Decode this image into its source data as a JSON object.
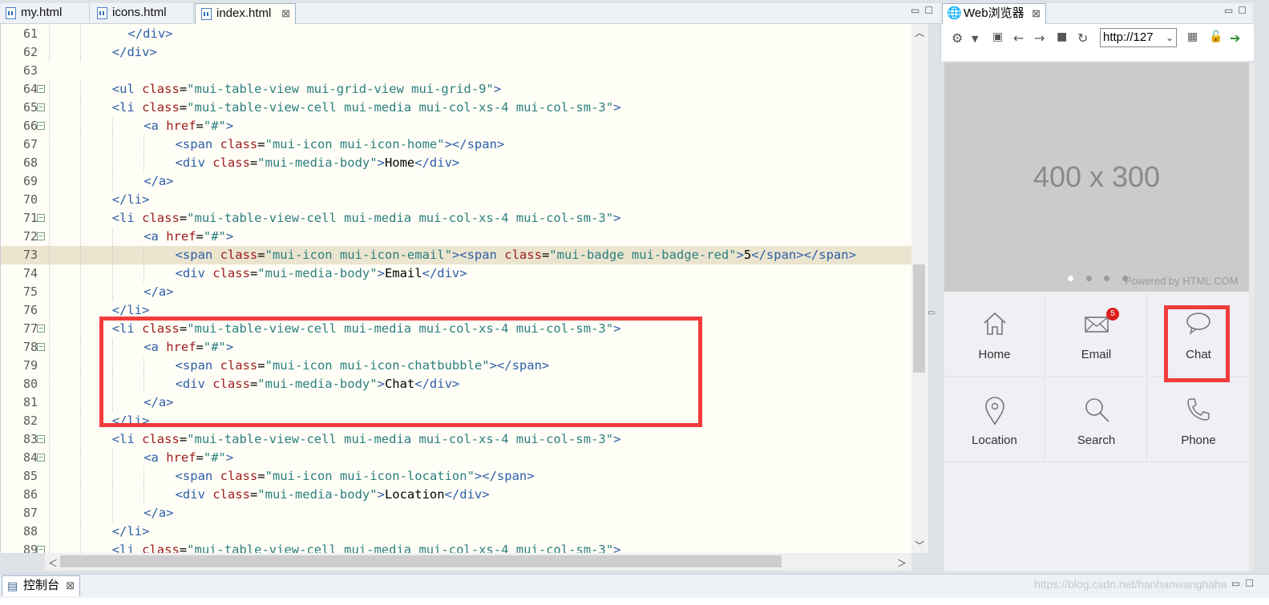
{
  "editor": {
    "tabs": [
      {
        "label": "my.html",
        "active": false
      },
      {
        "label": "icons.html",
        "active": false
      },
      {
        "label": "index.html",
        "active": true
      }
    ],
    "close_glyph": "⊠",
    "highlighted_line": 73,
    "lines": [
      {
        "n": "61",
        "fold": false,
        "indent": 5,
        "html": "<span class=\"tg\">&lt;/div&gt;</span>"
      },
      {
        "n": "62",
        "fold": false,
        "indent": 4,
        "html": "<span class=\"tg\">&lt;/div&gt;</span>"
      },
      {
        "n": "63",
        "fold": false,
        "indent": 0,
        "html": ""
      },
      {
        "n": "64",
        "fold": true,
        "indent": 4,
        "html": "<span class=\"tg\">&lt;ul</span> <span class=\"at\">class</span>=<span class=\"av\">\"mui-table-view mui-grid-view mui-grid-9\"</span><span class=\"tg\">&gt;</span>"
      },
      {
        "n": "65",
        "fold": true,
        "indent": 4,
        "html": "<span class=\"tg\">&lt;li</span> <span class=\"at\">class</span>=<span class=\"av\">\"mui-table-view-cell mui-media mui-col-xs-4 mui-col-sm-3\"</span><span class=\"tg\">&gt;</span>"
      },
      {
        "n": "66",
        "fold": true,
        "indent": 6,
        "html": "<span class=\"tg\">&lt;a</span> <span class=\"at\">href</span>=<span class=\"av\">\"#\"</span><span class=\"tg\">&gt;</span>"
      },
      {
        "n": "67",
        "fold": false,
        "indent": 8,
        "html": "<span class=\"tg\">&lt;span</span> <span class=\"at\">class</span>=<span class=\"av\">\"mui-icon mui-icon-home\"</span><span class=\"tg\">&gt;&lt;/span&gt;</span>"
      },
      {
        "n": "68",
        "fold": false,
        "indent": 8,
        "html": "<span class=\"tg\">&lt;div</span> <span class=\"at\">class</span>=<span class=\"av\">\"mui-media-body\"</span><span class=\"tg\">&gt;</span>Home<span class=\"tg\">&lt;/div&gt;</span>"
      },
      {
        "n": "69",
        "fold": false,
        "indent": 6,
        "html": "<span class=\"tg\">&lt;/a&gt;</span>"
      },
      {
        "n": "70",
        "fold": false,
        "indent": 4,
        "html": "<span class=\"tg\">&lt;/li&gt;</span>"
      },
      {
        "n": "71",
        "fold": true,
        "indent": 4,
        "html": "<span class=\"tg\">&lt;li</span> <span class=\"at\">class</span>=<span class=\"av\">\"mui-table-view-cell mui-media mui-col-xs-4 mui-col-sm-3\"</span><span class=\"tg\">&gt;</span>"
      },
      {
        "n": "72",
        "fold": true,
        "indent": 6,
        "html": "<span class=\"tg\">&lt;a</span> <span class=\"at\">href</span>=<span class=\"av\">\"#\"</span><span class=\"tg\">&gt;</span>"
      },
      {
        "n": "73",
        "fold": false,
        "indent": 8,
        "html": "<span class=\"tg\">&lt;span</span> <span class=\"at\">class</span>=<span class=\"av\">\"mui-icon mui-icon-email\"</span><span class=\"tg\">&gt;&lt;span</span> <span class=\"at\">class</span>=<span class=\"av\">\"mui-badge mui-badge-red\"</span><span class=\"tg\">&gt;</span>5<span class=\"tg\">&lt;/span&gt;&lt;/span&gt;</span>"
      },
      {
        "n": "74",
        "fold": false,
        "indent": 8,
        "html": "<span class=\"tg\">&lt;div</span> <span class=\"at\">class</span>=<span class=\"av\">\"mui-media-body\"</span><span class=\"tg\">&gt;</span>Email<span class=\"tg\">&lt;/div&gt;</span>"
      },
      {
        "n": "75",
        "fold": false,
        "indent": 6,
        "html": "<span class=\"tg\">&lt;/a&gt;</span>"
      },
      {
        "n": "76",
        "fold": false,
        "indent": 4,
        "html": "<span class=\"tg\">&lt;/li&gt;</span>"
      },
      {
        "n": "77",
        "fold": true,
        "indent": 4,
        "html": "<span class=\"tg\">&lt;li</span> <span class=\"at\">class</span>=<span class=\"av\">\"mui-table-view-cell mui-media mui-col-xs-4 mui-col-sm-3\"</span><span class=\"tg\">&gt;</span>"
      },
      {
        "n": "78",
        "fold": true,
        "indent": 6,
        "html": "<span class=\"tg\">&lt;a</span> <span class=\"at\">href</span>=<span class=\"av\">\"#\"</span><span class=\"tg\">&gt;</span>"
      },
      {
        "n": "79",
        "fold": false,
        "indent": 8,
        "html": "<span class=\"tg\">&lt;span</span> <span class=\"at\">class</span>=<span class=\"av\">\"mui-icon mui-icon-chatbubble\"</span><span class=\"tg\">&gt;&lt;/span&gt;</span>"
      },
      {
        "n": "80",
        "fold": false,
        "indent": 8,
        "html": "<span class=\"tg\">&lt;div</span> <span class=\"at\">class</span>=<span class=\"av\">\"mui-media-body\"</span><span class=\"tg\">&gt;</span>Chat<span class=\"tg\">&lt;/div&gt;</span>"
      },
      {
        "n": "81",
        "fold": false,
        "indent": 6,
        "html": "<span class=\"tg\">&lt;/a&gt;</span>"
      },
      {
        "n": "82",
        "fold": false,
        "indent": 4,
        "html": "<span class=\"tg\">&lt;/li&gt;</span>"
      },
      {
        "n": "83",
        "fold": true,
        "indent": 4,
        "html": "<span class=\"tg\">&lt;li</span> <span class=\"at\">class</span>=<span class=\"av\">\"mui-table-view-cell mui-media mui-col-xs-4 mui-col-sm-3\"</span><span class=\"tg\">&gt;</span>"
      },
      {
        "n": "84",
        "fold": true,
        "indent": 6,
        "html": "<span class=\"tg\">&lt;a</span> <span class=\"at\">href</span>=<span class=\"av\">\"#\"</span><span class=\"tg\">&gt;</span>"
      },
      {
        "n": "85",
        "fold": false,
        "indent": 8,
        "html": "<span class=\"tg\">&lt;span</span> <span class=\"at\">class</span>=<span class=\"av\">\"mui-icon mui-icon-location\"</span><span class=\"tg\">&gt;&lt;/span&gt;</span>"
      },
      {
        "n": "86",
        "fold": false,
        "indent": 8,
        "html": "<span class=\"tg\">&lt;div</span> <span class=\"at\">class</span>=<span class=\"av\">\"mui-media-body\"</span><span class=\"tg\">&gt;</span>Location<span class=\"tg\">&lt;/div&gt;</span>"
      },
      {
        "n": "87",
        "fold": false,
        "indent": 6,
        "html": "<span class=\"tg\">&lt;/a&gt;</span>"
      },
      {
        "n": "88",
        "fold": false,
        "indent": 4,
        "html": "<span class=\"tg\">&lt;/li&gt;</span>"
      },
      {
        "n": "89",
        "fold": true,
        "indent": 4,
        "html": "<span class=\"tg\">&lt;li</span> <span class=\"at\">class</span>=<span class=\"av\">\"mui-table-view-cell mui-media mui-col-xs-4 mui-col-sm-3\"</span><span class=\"tg\">&gt;</span>"
      }
    ]
  },
  "browser": {
    "tab_label": "Web浏览器",
    "url": "http://127",
    "slider_text": "400 x 300",
    "powered_text": "Powered by HTML.COM",
    "grid_items": [
      {
        "label": "Home",
        "icon": "home-icon"
      },
      {
        "label": "Email",
        "icon": "email-icon",
        "badge": "5"
      },
      {
        "label": "Chat",
        "icon": "chat-bubble-icon"
      },
      {
        "label": "Location",
        "icon": "location-icon"
      },
      {
        "label": "Search",
        "icon": "search-icon"
      },
      {
        "label": "Phone",
        "icon": "phone-icon"
      }
    ]
  },
  "console": {
    "tab_label": "控制台"
  },
  "watermark": "https://blog.csdn.net/hanhanwanghaha",
  "colors": {
    "highlight_box": "#f23b3b",
    "badge": "#dd1e1e",
    "tag": "#2d5ea8",
    "attr": "#9b1b1b",
    "value": "#2a7f7f"
  }
}
